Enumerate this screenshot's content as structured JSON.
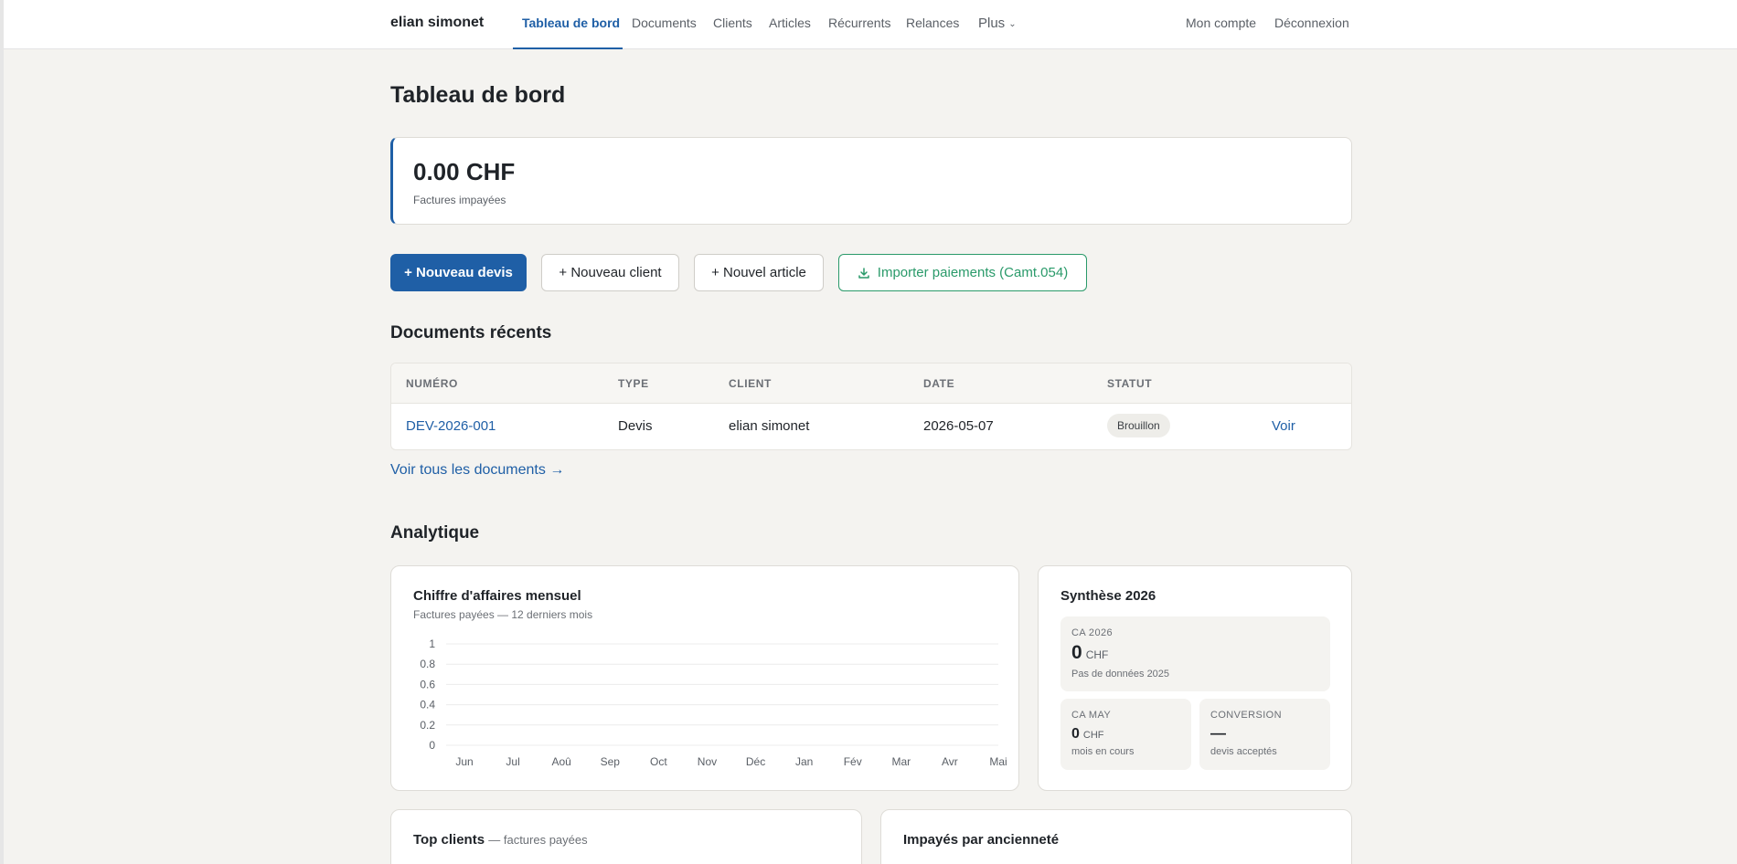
{
  "nav": {
    "brand": "elian simonet",
    "links": [
      "Tableau de bord",
      "Documents",
      "Clients",
      "Articles",
      "Récurrents",
      "Relances",
      "Plus"
    ],
    "account": "Mon compte",
    "logout": "Déconnexion"
  },
  "page_title": "Tableau de bord",
  "kpi": {
    "value": "0.00 CHF",
    "label": "Factures impayées"
  },
  "actions": {
    "new_quote": "+ Nouveau devis",
    "new_client": "+ Nouveau client",
    "new_article": "+ Nouvel article",
    "import_payments": "Importer paiements (Camt.054)"
  },
  "recent_docs": {
    "title": "Documents récents",
    "columns": [
      "NUMÉRO",
      "TYPE",
      "CLIENT",
      "DATE",
      "STATUT"
    ],
    "rows": [
      {
        "number": "DEV-2026-001",
        "type": "Devis",
        "client": "elian simonet",
        "date": "2026-05-07",
        "status": "Brouillon",
        "action": "Voir"
      }
    ],
    "see_all": "Voir tous les documents →"
  },
  "analytics": {
    "title": "Analytique",
    "revenue_chart": {
      "title": "Chiffre d'affaires mensuel",
      "subtitle": "Factures payées — 12 derniers mois"
    },
    "synthesis": {
      "title": "Synthèse 2026",
      "ca_year_label": "CA 2026",
      "ca_year_value": "0",
      "ca_year_unit": "CHF",
      "ca_year_note": "Pas de données 2025",
      "ca_month_label": "CA MAY",
      "ca_month_value": "0",
      "ca_month_unit": "CHF",
      "ca_month_note": "mois en cours",
      "conversion_label": "CONVERSION",
      "conversion_value": "—",
      "conversion_note": "devis acceptés"
    },
    "top_clients": {
      "title": "Top clients",
      "subtitle": "— factures payées"
    },
    "unpaid_aging": {
      "title": "Impayés par ancienneté"
    }
  },
  "chart_data": {
    "type": "line",
    "title": "Chiffre d'affaires mensuel",
    "subtitle": "Factures payées — 12 derniers mois",
    "categories": [
      "Jun",
      "Jul",
      "Aoû",
      "Sep",
      "Oct",
      "Nov",
      "Déc",
      "Jan",
      "Fév",
      "Mar",
      "Avr",
      "Mai"
    ],
    "series": [
      {
        "values": [
          0,
          0,
          0,
          0,
          0,
          0,
          0,
          0,
          0,
          0,
          0,
          0
        ]
      }
    ],
    "y_ticks": [
      "1",
      "0.8",
      "0.6",
      "0.4",
      "0.2",
      "0"
    ],
    "ylim": [
      0,
      1
    ],
    "grid": true
  },
  "colors": {
    "accent": "#1f5fa6",
    "success": "#2a9a6a",
    "background": "#f4f3f0"
  }
}
